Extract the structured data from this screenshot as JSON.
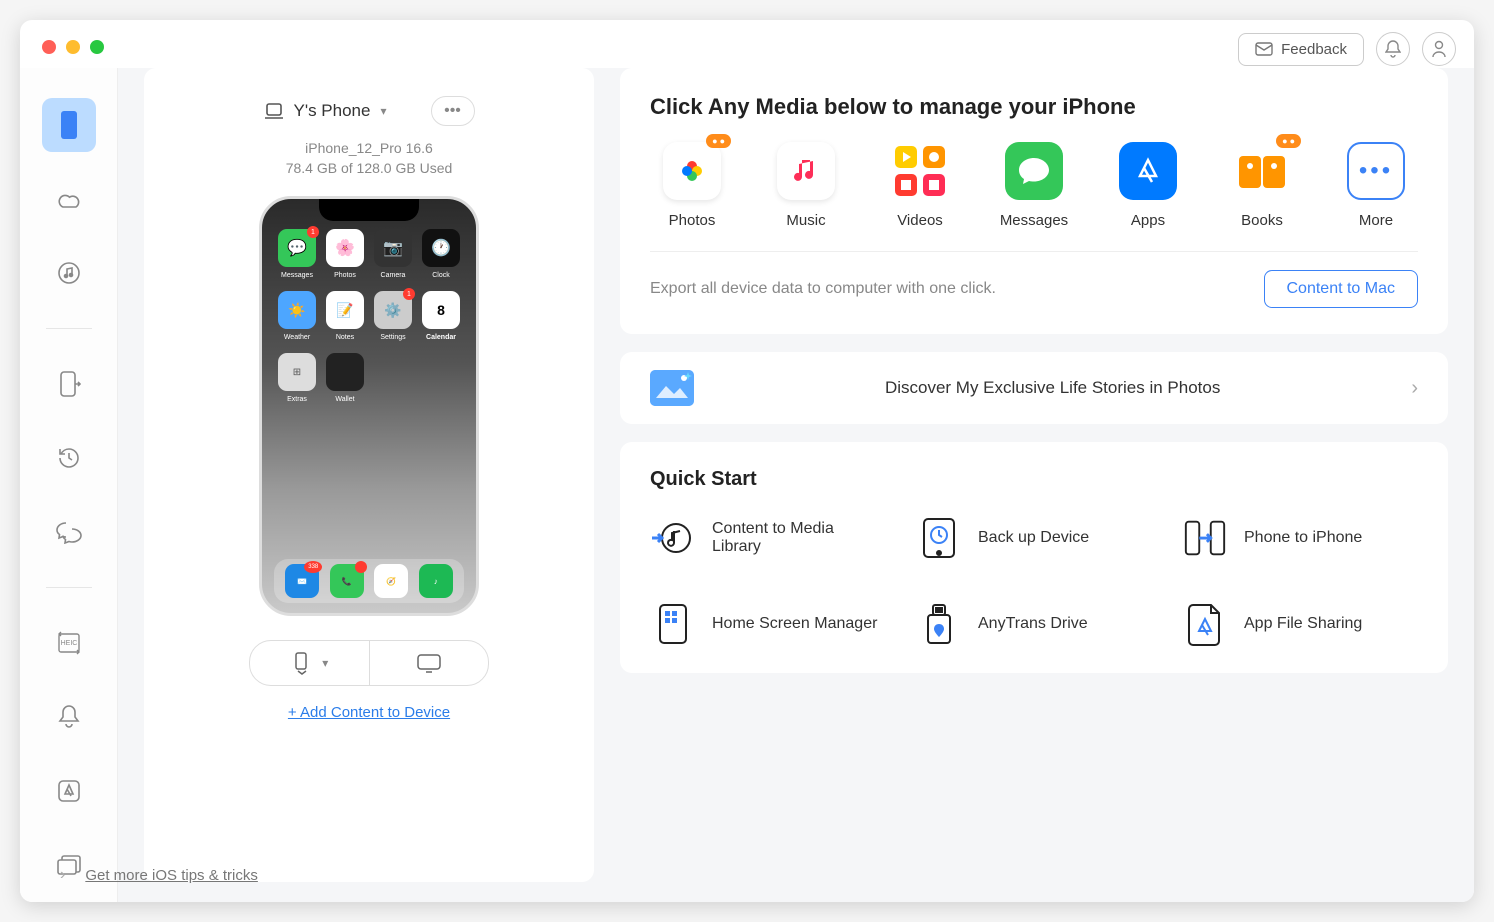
{
  "topbar": {
    "feedback": "Feedback"
  },
  "device": {
    "name": "Y's Phone",
    "model": "iPhone_12_Pro 16.6",
    "storage": "78.4 GB of  128.0 GB Used",
    "addContent": "+ Add Content to Device"
  },
  "phoneApps": {
    "row1": [
      "Messages",
      "Photos",
      "Camera",
      "Clock"
    ],
    "row2": [
      "Weather",
      "Notes",
      "Settings",
      "Calendar"
    ],
    "row3": [
      "Extras",
      "Wallet",
      "",
      ""
    ],
    "calendarDay": "8",
    "mailBadge": "338"
  },
  "mediaSection": {
    "title": "Click Any Media below to manage your iPhone",
    "items": [
      "Photos",
      "Music",
      "Videos",
      "Messages",
      "Apps",
      "Books",
      "More"
    ],
    "exportText": "Export all device data to computer with one click.",
    "contentToMac": "Content to Mac"
  },
  "discover": {
    "text": "Discover My Exclusive Life Stories in Photos"
  },
  "quickStart": {
    "title": "Quick Start",
    "items": [
      "Content to Media Library",
      "Back up Device",
      "Phone to iPhone",
      "Home Screen Manager",
      "AnyTrans Drive",
      "App File Sharing"
    ]
  },
  "footer": {
    "tips": "Get more iOS tips & tricks"
  }
}
